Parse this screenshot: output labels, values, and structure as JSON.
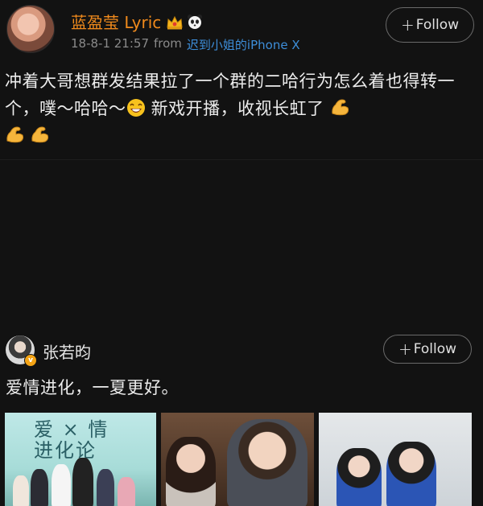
{
  "post1": {
    "username": "蓝盈莹 Lyric",
    "date": "18-8-1 21:57",
    "from_label": "from",
    "source": "迟到小姐的iPhone X",
    "follow_label": "Follow",
    "text_part1": "冲着大哥想群发结果拉了一个群的二哈行为怎么着也得转一个，噗～哈哈～",
    "text_part2": " 新戏开播，收视长虹了",
    "icons": [
      "crown-icon",
      "panda-icon",
      "laughing-emoji-icon",
      "flexed-biceps-icon"
    ]
  },
  "post2": {
    "username": "张若昀",
    "follow_label": "Follow",
    "text": "爱情进化，一夏更好。",
    "poster_title_line1": "爱 × 情",
    "poster_title_line2": "进化论"
  },
  "colors": {
    "background": "#121212",
    "username_orange": "#f08a1c",
    "link_blue": "#3d8dd8",
    "meta_gray": "#8a8a8a",
    "verified_gold": "#f3a315"
  }
}
